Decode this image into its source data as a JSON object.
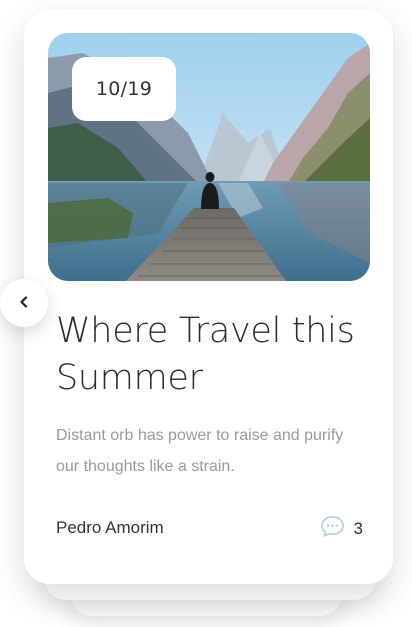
{
  "card": {
    "counter": "10/19",
    "title": "Where Travel this Summer",
    "excerpt": "Distant orb has power to raise and purify our thoughts like a strain.",
    "author": "Pedro Amorim",
    "comment_count": "3",
    "image_alt": "Person sitting at the end of a wooden dock on a mountain lake"
  },
  "icons": {
    "prev": "chevron-left-icon",
    "comments": "speech-bubble-icon"
  },
  "colors": {
    "title": "#2c2c2c",
    "excerpt": "#9a9a9a",
    "comment_icon": "#b7d3e2",
    "background": "#ffffff"
  }
}
